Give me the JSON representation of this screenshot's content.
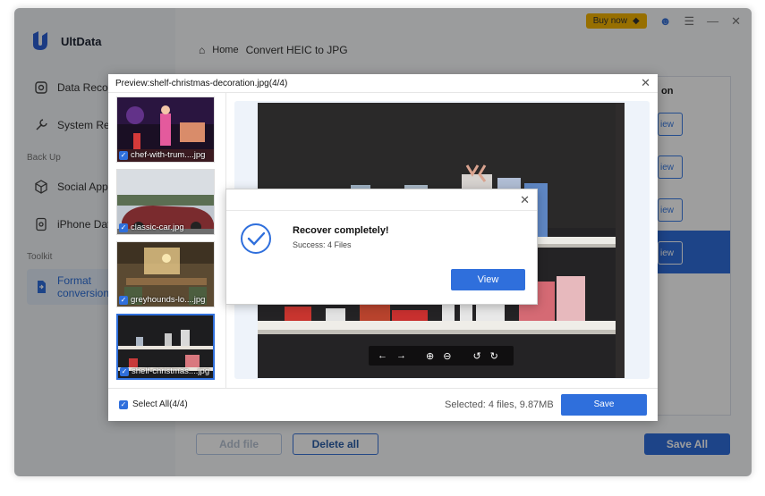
{
  "app": {
    "name": "UltData"
  },
  "sidebar": {
    "items": [
      {
        "label": "Data Recovery",
        "icon": "data-recovery-icon"
      },
      {
        "label": "System Repair",
        "icon": "wrench-icon"
      }
    ],
    "backup_label": "Back Up",
    "backup_items": [
      {
        "label": "Social App",
        "icon": "cube-icon"
      },
      {
        "label": "iPhone Data",
        "icon": "phone-data-icon"
      }
    ],
    "toolkit_label": "Toolkit",
    "toolkit_items": [
      {
        "label": "Format conversion",
        "icon": "file-convert-icon"
      }
    ]
  },
  "header": {
    "breadcrumb_home": "Home",
    "breadcrumb_page": "Convert HEIC to JPG",
    "buy_now": "Buy now"
  },
  "side_table": {
    "header": "on",
    "rows": [
      "iew",
      "iew",
      "iew",
      "iew"
    ]
  },
  "bottom": {
    "add_file": "Add file",
    "delete_all": "Delete all",
    "save_all": "Save All"
  },
  "preview": {
    "title": "Preview:shelf-christmas-decoration.jpg(4/4)",
    "thumbnails": [
      {
        "caption": "chef-with-trum....jpg"
      },
      {
        "caption": "classic-car.jpg"
      },
      {
        "caption": "greyhounds-lo....jpg"
      },
      {
        "caption": "shelf-christmas....jpg"
      }
    ],
    "select_all": "Select All(4/4)",
    "selected_info": "Selected: 4 files, 9.87MB",
    "save": "Save"
  },
  "recover_dialog": {
    "title": "Recover completely!",
    "subtitle": "Success: 4 Files",
    "view": "View"
  },
  "colors": {
    "accent": "#2f6fdc",
    "buy": "#f4b400"
  }
}
